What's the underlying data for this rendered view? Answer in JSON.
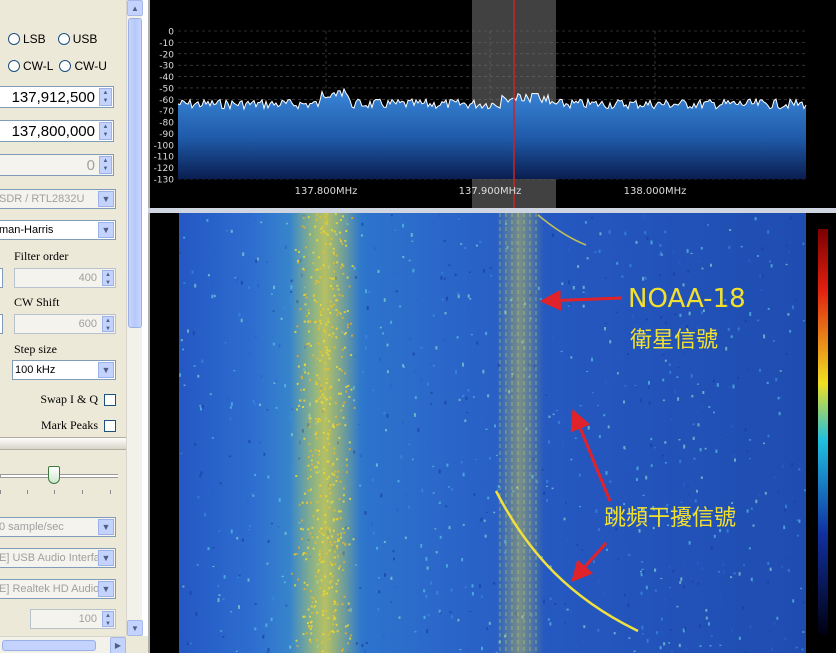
{
  "modes": {
    "lsb": "LSB",
    "usb": "USB",
    "cwl": "CW-L",
    "cwu": "CW-U"
  },
  "frequency": {
    "center": "137,912,500",
    "lo": "137,800,000",
    "shift": "0"
  },
  "device_combo": "SDR / RTL2832U",
  "window_combo": "man-Harris",
  "filter_order": {
    "label": "Filter order",
    "value": "400"
  },
  "cw_shift": {
    "label": "CW Shift",
    "value": "600"
  },
  "step_size": {
    "label": "Step size",
    "value": "100 kHz"
  },
  "swap_iq": {
    "label": "Swap I & Q"
  },
  "mark_peaks": {
    "label": "Mark Peaks"
  },
  "audio": {
    "sample_rate": "0 sample/sec",
    "input_device": "E] USB Audio Interfa",
    "output_device": "E] Realtek HD Audio",
    "latency": "100"
  },
  "spectrum": {
    "y_ticks": [
      "0",
      "-10",
      "-20",
      "-30",
      "-40",
      "-50",
      "-60",
      "-70",
      "-80",
      "-90",
      "-100",
      "-110",
      "-120",
      "-130"
    ],
    "x_ticks": [
      "137.800MHz",
      "137.900MHz",
      "138.000MHz"
    ],
    "colors": {
      "fill": "#2a6fc0",
      "line": "#ffffff",
      "tuner": "#cc2222",
      "filter_band": "#6a6a6a"
    }
  },
  "annotations": {
    "satellite_name": "NOAA-18",
    "satellite_caption": "衛星信號",
    "interference_caption": "跳頻干擾信號",
    "color": "#f2e02e",
    "arrow_color": "#e0222a"
  }
}
